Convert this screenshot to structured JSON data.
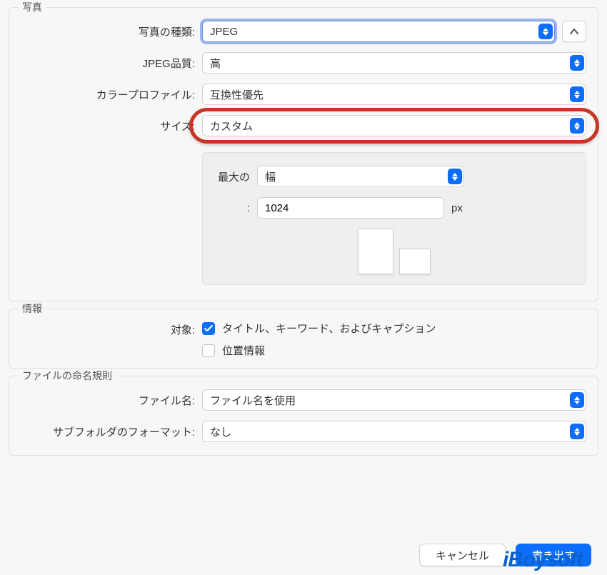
{
  "photo": {
    "legend": "写真",
    "type_label": "写真の種類:",
    "type_value": "JPEG",
    "quality_label": "JPEG品質:",
    "quality_value": "高",
    "profile_label": "カラープロファイル:",
    "profile_value": "互換性優先",
    "size_label": "サイズ:",
    "size_value": "カスタム",
    "max_label": "最大の",
    "max_value": "幅",
    "dimension_label": ":",
    "dimension_value": "1024",
    "dimension_unit": "px"
  },
  "info": {
    "legend": "情報",
    "target_label": "対象:",
    "title_keywords_label": "タイトル、キーワード、およびキャプション",
    "title_keywords_checked": true,
    "location_label": "位置情報",
    "location_checked": false
  },
  "naming": {
    "legend": "ファイルの命名規則",
    "filename_label": "ファイル名:",
    "filename_value": "ファイル名を使用",
    "subfolder_label": "サブフォルダのフォーマット:",
    "subfolder_value": "なし"
  },
  "footer": {
    "cancel": "キャンセル",
    "export": "書き出す"
  },
  "watermark": "iBoysoft"
}
